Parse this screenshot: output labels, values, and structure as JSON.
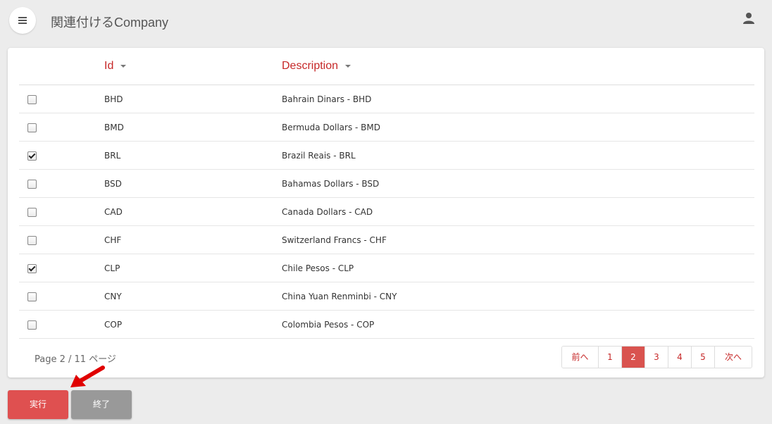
{
  "header": {
    "title": "関連付けるCompany"
  },
  "table": {
    "columns": [
      {
        "label": "Id"
      },
      {
        "label": "Description"
      }
    ],
    "rows": [
      {
        "id": "BHD",
        "description": "Bahrain Dinars - BHD",
        "checked": false
      },
      {
        "id": "BMD",
        "description": "Bermuda Dollars - BMD",
        "checked": false
      },
      {
        "id": "BRL",
        "description": "Brazil Reais - BRL",
        "checked": true
      },
      {
        "id": "BSD",
        "description": "Bahamas Dollars - BSD",
        "checked": false
      },
      {
        "id": "CAD",
        "description": "Canada Dollars - CAD",
        "checked": false
      },
      {
        "id": "CHF",
        "description": "Switzerland Francs - CHF",
        "checked": false
      },
      {
        "id": "CLP",
        "description": "Chile Pesos - CLP",
        "checked": true
      },
      {
        "id": "CNY",
        "description": "China Yuan Renminbi - CNY",
        "checked": false
      },
      {
        "id": "COP",
        "description": "Colombia Pesos - COP",
        "checked": false
      }
    ]
  },
  "pagination": {
    "info": "Page 2  /  11 ページ",
    "prev_label": "前へ",
    "next_label": "次へ",
    "pages": [
      "1",
      "2",
      "3",
      "4",
      "5"
    ],
    "current": "2"
  },
  "actions": {
    "run_label": "実行",
    "end_label": "終了"
  },
  "colors": {
    "accent": "#c62828",
    "run_button": "#df5050",
    "end_button": "#999999",
    "arrow": "#e00000"
  },
  "icons": {
    "menu": "hamburger-menu-icon",
    "user": "user-icon",
    "sort": "caret-down-icon",
    "annotation": "red-arrow-icon"
  }
}
